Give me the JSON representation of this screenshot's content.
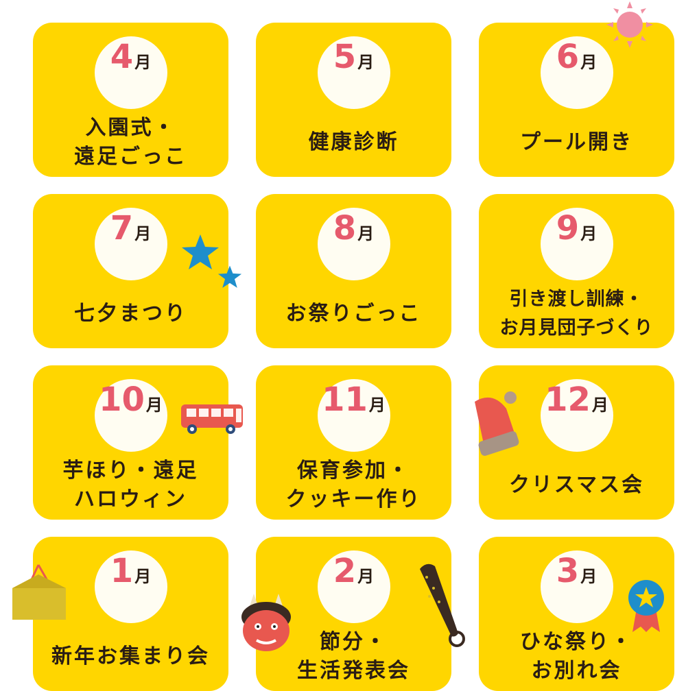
{
  "month_suffix": "月",
  "cards": [
    {
      "month": "4",
      "lines": [
        "入園式・",
        "遠足ごっこ"
      ]
    },
    {
      "month": "5",
      "lines": [
        "健康診断"
      ]
    },
    {
      "month": "6",
      "lines": [
        "プール開き"
      ]
    },
    {
      "month": "7",
      "lines": [
        "七夕まつり"
      ]
    },
    {
      "month": "8",
      "lines": [
        "お祭りごっこ"
      ]
    },
    {
      "month": "9",
      "lines": [
        "引き渡し訓練・",
        "お月見団子づくり"
      ]
    },
    {
      "month": "10",
      "lines": [
        "芋ほり・遠足",
        "ハロウィン"
      ]
    },
    {
      "month": "11",
      "lines": [
        "保育参加・",
        "クッキー作り"
      ]
    },
    {
      "month": "12",
      "lines": [
        "クリスマス会"
      ]
    },
    {
      "month": "1",
      "lines": [
        "新年お集まり会"
      ]
    },
    {
      "month": "2",
      "lines": [
        "節分・",
        "生活発表会"
      ]
    },
    {
      "month": "3",
      "lines": [
        "ひな祭り・",
        "お別れ会"
      ]
    }
  ],
  "decorations": [
    "sun-icon",
    "star-icon",
    "bus-icon",
    "santa-hat-icon",
    "ema-plaque-icon",
    "oni-demon-icon",
    "oni-club-icon",
    "medal-icon"
  ],
  "colors": {
    "card": "#ffd600",
    "circle": "#fffdf2",
    "month_number": "#e65a6c",
    "text": "#2a1d14"
  }
}
